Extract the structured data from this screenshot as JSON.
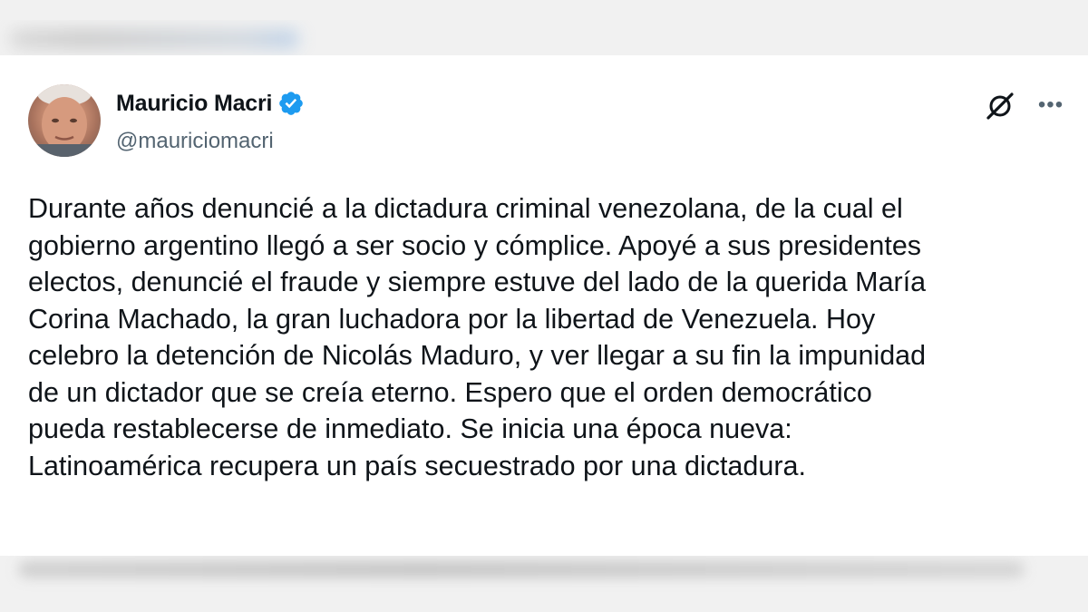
{
  "author": {
    "name": "Mauricio Macri",
    "handle": "@mauriciomacri",
    "verified": true
  },
  "icons": {
    "verified": "verified-badge-icon",
    "grok": "grok-icon",
    "more": "more-icon"
  },
  "colors": {
    "verified_badge": "#1d9bf0",
    "text_primary": "#0f1419",
    "text_secondary": "#536471"
  },
  "tweet": {
    "text": "Durante años denuncié a la dictadura criminal venezolana, de la cual el\ngobierno argentino llegó a ser socio y cómplice. Apoyé a sus presidentes\nelectos, denuncié el fraude y siempre estuve del lado de la querida María\nCorina Machado, la gran luchadora por la libertad de Venezuela. Hoy\ncelebro la detención de Nicolás Maduro, y ver llegar a su fin la impunidad\nde un dictador que se creía eterno. Espero que el orden democrático\npueda restablecerse de inmediato. Se inicia una época nueva:\nLatinoamérica recupera un país secuestrado por una dictadura."
  }
}
